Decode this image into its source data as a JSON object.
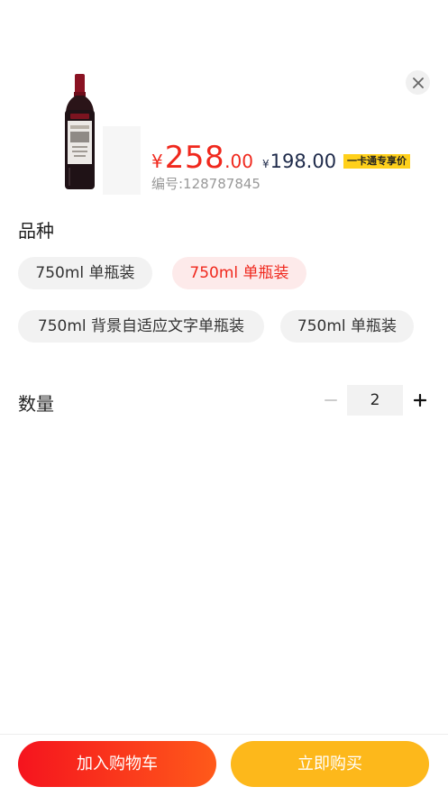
{
  "product": {
    "price_symbol": "¥",
    "price_integer": "258",
    "price_decimal": ".00",
    "member_price_symbol": "¥",
    "member_price": "198.00",
    "member_badge": "一卡通专享价",
    "code_text": "编号:128787845"
  },
  "spec": {
    "title": "品种",
    "options": [
      {
        "label": "750ml 单瓶装",
        "selected": false
      },
      {
        "label": "750ml 单瓶装",
        "selected": true
      },
      {
        "label": "750ml 背景自适应文字单瓶装",
        "selected": false
      },
      {
        "label": "750ml 单瓶装",
        "selected": false
      }
    ]
  },
  "quantity": {
    "title": "数量",
    "value": "2"
  },
  "actions": {
    "add_to_cart": "加入购物车",
    "buy_now": "立即购买"
  },
  "icons": {
    "close": "close-icon",
    "minus": "minus-icon",
    "plus": "plus-icon"
  },
  "colors": {
    "primary_red": "#f0281d",
    "member_badge_bg": "#ffd01b",
    "buy_button": "#fdb81b",
    "selected_variant_bg": "#fdeaea"
  }
}
